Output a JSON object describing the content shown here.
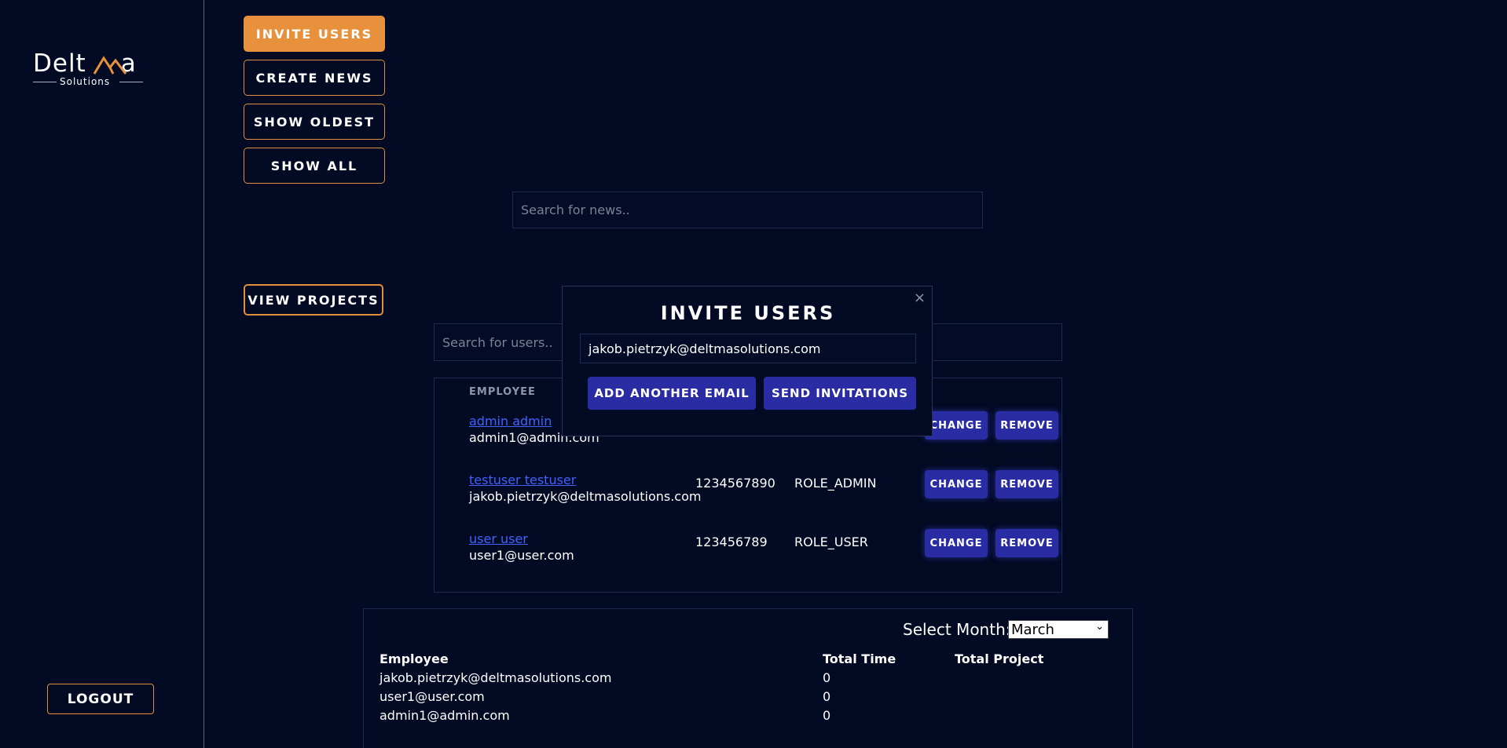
{
  "brand": {
    "name_left": "Delt",
    "name_right": "a",
    "subtitle": "Solutions",
    "accent": "#e8913c"
  },
  "sidebar": {
    "logout_label": "LOGOUT"
  },
  "actions": {
    "invite_users": "INVITE USERS",
    "create_news": "CREATE NEWS",
    "show_oldest": "SHOW OLDEST",
    "show_all": "SHOW ALL",
    "view_projects": "VIEW PROJECTS"
  },
  "news_search": {
    "placeholder": "Search for news.."
  },
  "user_search": {
    "placeholder": "Search for users.."
  },
  "users_table": {
    "column_header": "EMPLOYEE",
    "rows": [
      {
        "name": "admin admin",
        "email": "admin1@admin.com",
        "phone": "",
        "role": "",
        "change": "CHANGE",
        "remove": "REMOVE"
      },
      {
        "name": "testuser testuser",
        "email": "jakob.pietrzyk@deltmasolutions.com",
        "phone": "1234567890",
        "role": "ROLE_ADMIN",
        "change": "CHANGE",
        "remove": "REMOVE"
      },
      {
        "name": "user user",
        "email": "user1@user.com",
        "phone": "123456789",
        "role": "ROLE_USER",
        "change": "CHANGE",
        "remove": "REMOVE"
      }
    ]
  },
  "report": {
    "select_label": "Select Month:",
    "selected_month": "March",
    "headers": {
      "employee": "Employee",
      "total_time": "Total Time",
      "total_project": "Total Project"
    },
    "rows": [
      {
        "employee": "jakob.pietrzyk@deltmasolutions.com",
        "total_time": "0",
        "total_project": ""
      },
      {
        "employee": "user1@user.com",
        "total_time": "0",
        "total_project": ""
      },
      {
        "employee": "admin1@admin.com",
        "total_time": "0",
        "total_project": ""
      }
    ]
  },
  "invite_modal": {
    "title": "INVITE USERS",
    "close_glyph": "×",
    "email_value": "jakob.pietrzyk@deltmasolutions.com",
    "add_email_label": "ADD ANOTHER EMAIL",
    "send_label": "SEND INVITATIONS"
  }
}
